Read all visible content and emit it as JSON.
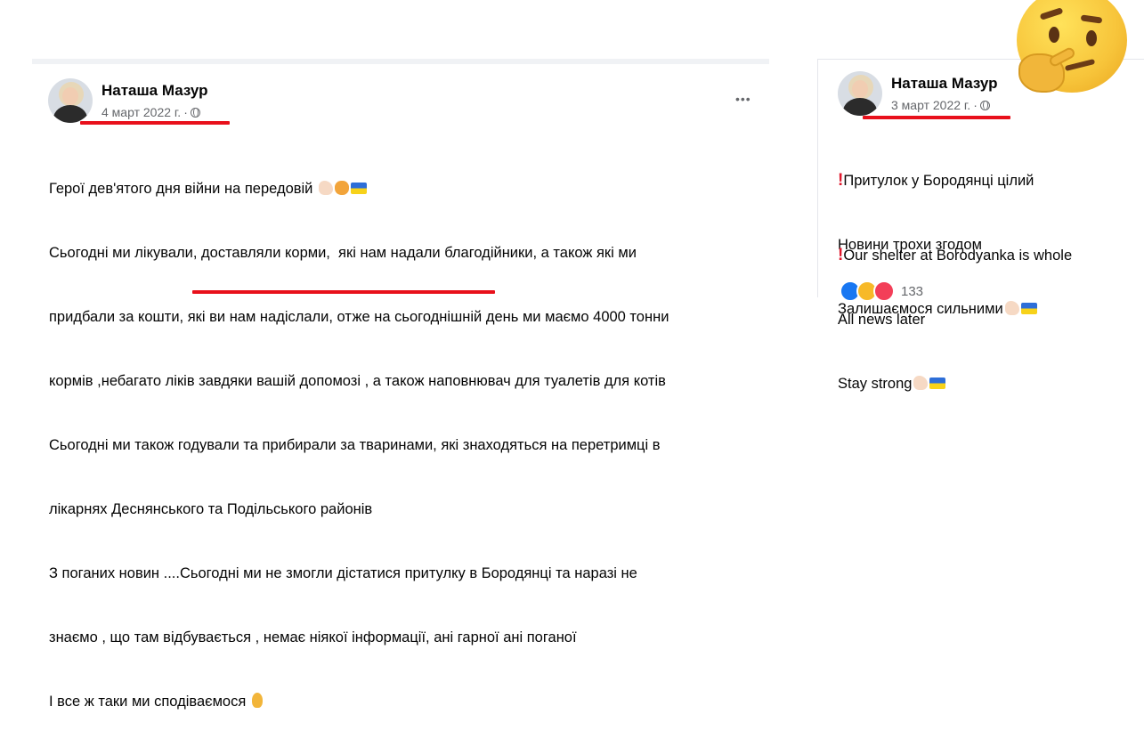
{
  "left_post": {
    "author": "Наташа Мазур",
    "date": "4 март 2022 г.",
    "separator": "·",
    "more": "•••",
    "lines": [
      "Герої дев'ятого дня війни на передовій ",
      "Сьогодні ми лікували, доставляли корми,  які нам надали благодійники, а також які ми",
      "придбали за кошти, які ви нам надіслали, отже на сьогоднішній день ми маємо 4000 тонни",
      "кормів ,небагато ліків завдяки вашій допомозі , а також наповнювач для туалетів для котів",
      "Сьогодні ми також годували та прибирали за тваринами, які знаходяться на перетримці в",
      "лікарнях Деснянського та Подільського районів",
      "З поганих новин ....Сьогодні ми не змогли дістатися притулку в Бородянці та наразі не",
      "знаємо , що там відбувається , немає ніякої інформації, ані гарної ані поганої",
      "І все ж таки ми сподіваємося "
    ]
  },
  "right_post": {
    "author": "Наташа Мазур",
    "date": "3 март 2022 г.",
    "separator": "·",
    "lines": [
      "Притулок у Бородянці цілий",
      "Новини трохи згодом",
      "Залишаємося сильними",
      "Our shelter at Borodyanka is whole",
      "All news later",
      "Stay strong"
    ],
    "reaction_count": "133"
  },
  "colors": {
    "highlight_red": "#e8101b",
    "secondary_text": "#65676b",
    "flag_blue": "#2d6ed8",
    "flag_yellow": "#f7d21a"
  },
  "icons": [
    "globe-icon",
    "more-options-icon",
    "flexed-arm-emoji",
    "raised-fist-emoji",
    "ukraine-flag-emoji",
    "crossed-fingers-emoji",
    "exclamation-emoji",
    "like-reaction-icon",
    "care-reaction-icon",
    "love-reaction-icon",
    "thinking-face-emoji"
  ]
}
